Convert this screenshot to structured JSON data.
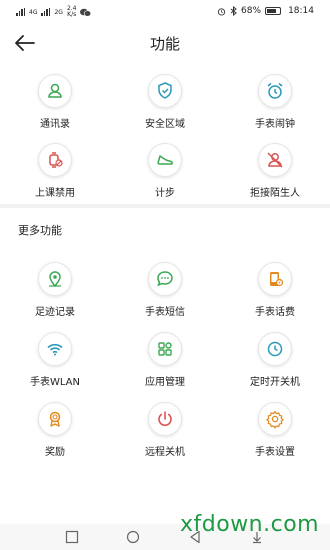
{
  "statusbar": {
    "network_left": "4G",
    "network_right": "2G",
    "speed_value": "2.4",
    "speed_unit": "K/s",
    "battery": "68%",
    "time": "18:14"
  },
  "header": {
    "title": "功能"
  },
  "top_functions": [
    {
      "label": "通讯录",
      "icon": "contacts-icon",
      "color": "#3aa852"
    },
    {
      "label": "安全区域",
      "icon": "safe-zone-icon",
      "color": "#2a9ab8"
    },
    {
      "label": "手表闹钟",
      "icon": "alarm-clock-icon",
      "color": "#2a9ab8"
    },
    {
      "label": "上课禁用",
      "icon": "class-disable-icon",
      "color": "#d9534f"
    },
    {
      "label": "计步",
      "icon": "shoe-icon",
      "color": "#3aa852"
    },
    {
      "label": "拒接陌生人",
      "icon": "block-stranger-icon",
      "color": "#d9534f"
    }
  ],
  "more": {
    "title": "更多功能",
    "items": [
      {
        "label": "足迹记录",
        "icon": "location-pin-icon",
        "color": "#3aa852"
      },
      {
        "label": "手表短信",
        "icon": "message-icon",
        "color": "#3aa852"
      },
      {
        "label": "手表话费",
        "icon": "phone-bill-icon",
        "color": "#e08a1e"
      },
      {
        "label": "手表WLAN",
        "icon": "wifi-icon",
        "color": "#2a9ab8"
      },
      {
        "label": "应用管理",
        "icon": "apps-icon",
        "color": "#3aa852"
      },
      {
        "label": "定时开关机",
        "icon": "timer-icon",
        "color": "#2a9ab8"
      },
      {
        "label": "奖励",
        "icon": "medal-icon",
        "color": "#e08a1e"
      },
      {
        "label": "远程关机",
        "icon": "power-icon",
        "color": "#d9534f"
      },
      {
        "label": "手表设置",
        "icon": "gear-icon",
        "color": "#e08a1e"
      }
    ]
  },
  "watermark": "xfdown.com"
}
